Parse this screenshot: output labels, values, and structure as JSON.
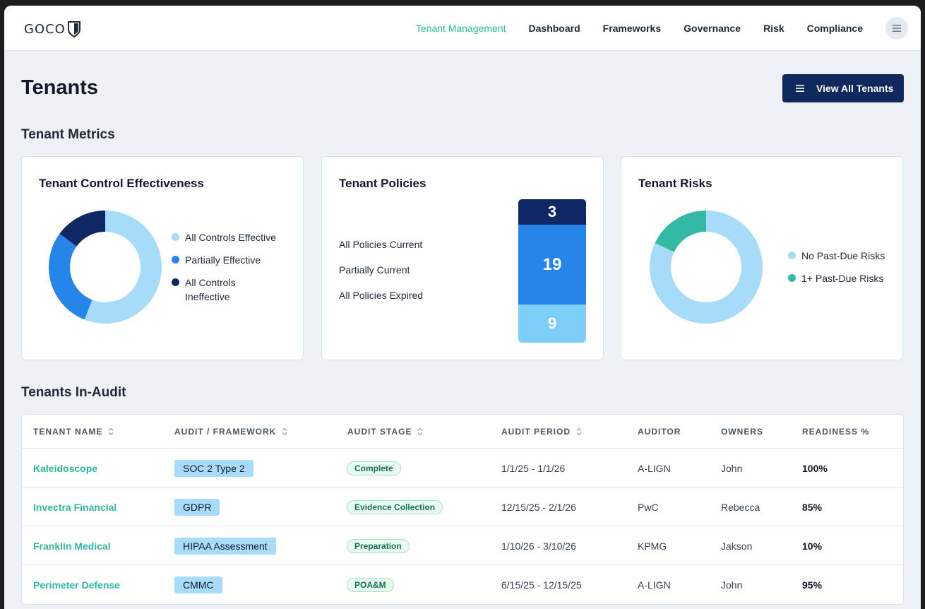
{
  "brand": {
    "logo_text": "GOCO"
  },
  "nav": {
    "links": [
      "Tenant Management",
      "Dashboard",
      "Frameworks",
      "Governance",
      "Risk",
      "Compliance"
    ],
    "active": "Tenant Management",
    "menu_icon": "hamburger-icon"
  },
  "page": {
    "title": "Tenants",
    "view_all_label": "View All Tenants",
    "metrics_title": "Tenant Metrics",
    "audit_title": "Tenants In-Audit"
  },
  "cards": {
    "control": {
      "title": "Tenant Control Effectiveness",
      "legend": [
        {
          "label": "All Controls Effective",
          "color": "#a6dcfa"
        },
        {
          "label": "Partially Effective",
          "color": "#2585e9"
        },
        {
          "label": "All Controls Ineffective",
          "color": "#0f2865"
        }
      ]
    },
    "policies": {
      "title": "Tenant Policies",
      "labels": [
        "All Policies Current",
        "Partially Current",
        "All Policies Expired"
      ]
    },
    "risks": {
      "title": "Tenant Risks",
      "legend": [
        {
          "label": "No Past-Due Risks",
          "color": "#a6dcfa"
        },
        {
          "label": "1+ Past-Due Risks",
          "color": "#33b9a4"
        }
      ]
    }
  },
  "chart_data": [
    {
      "type": "pie",
      "categories": [
        "All Controls Effective",
        "Partially Effective",
        "All Controls Ineffective"
      ],
      "values": [
        56,
        29,
        15
      ],
      "colors": [
        "#a6dcfa",
        "#2585e9",
        "#0f2865"
      ],
      "donut": true
    },
    {
      "type": "bar",
      "stacked": true,
      "categories": [
        "All Policies Current",
        "Partially Current",
        "All Policies Expired"
      ],
      "values": [
        9,
        19,
        3
      ],
      "colors": [
        "#7dcffa",
        "#2585e9",
        "#0f2865"
      ]
    },
    {
      "type": "pie",
      "categories": [
        "No Past-Due Risks",
        "1+ Past-Due Risks"
      ],
      "values": [
        82,
        18
      ],
      "colors": [
        "#a6dcfa",
        "#33b9a4"
      ],
      "donut": true
    }
  ],
  "table": {
    "columns": [
      "TENANT NAME",
      "AUDIT / FRAMEWORK",
      "AUDIT STAGE",
      "AUDIT PERIOD",
      "AUDITOR",
      "OWNERS",
      "READINESS %"
    ],
    "rows": [
      {
        "tenant": "Kaleidoscope",
        "framework": "SOC 2 Type 2",
        "stage": "Complete",
        "period": "1/1/25 - 1/1/26",
        "auditor": "A-LIGN",
        "owner": "John",
        "readiness": "100%"
      },
      {
        "tenant": "Invectra Financial",
        "framework": "GDPR",
        "stage": "Evidence Collection",
        "period": "12/15/25 - 2/1/26",
        "auditor": "PwC",
        "owner": "Rebecca",
        "readiness": "85%"
      },
      {
        "tenant": "Franklin Medical",
        "framework": "HIPAA Assessment",
        "stage": "Preparation",
        "period": "1/10/26 - 3/10/26",
        "auditor": "KPMG",
        "owner": "Jakson",
        "readiness": "10%"
      },
      {
        "tenant": "Perimeter Defense",
        "framework": "CMMC",
        "stage": "POA&M",
        "period": "6/15/25 - 12/15/25",
        "auditor": "A-LIGN",
        "owner": "John",
        "readiness": "95%"
      }
    ]
  }
}
